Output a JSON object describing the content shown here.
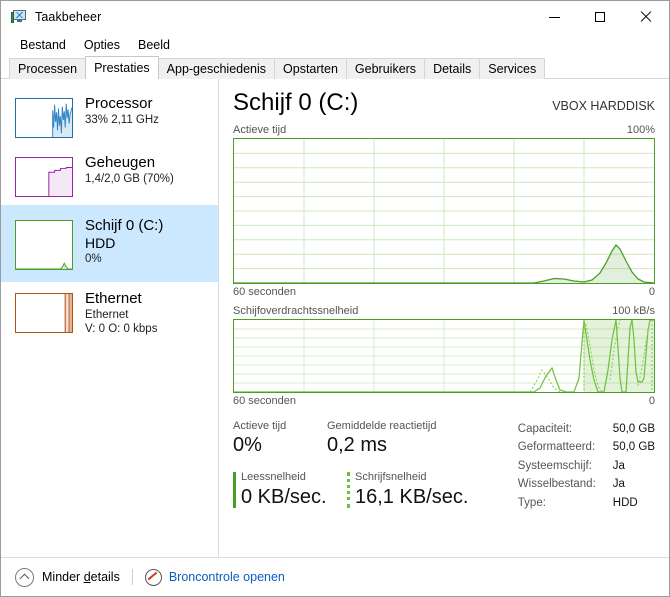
{
  "window": {
    "title": "Taakbeheer",
    "icon": "task-manager-icon",
    "controls": {
      "minimize": "—",
      "maximize": "□",
      "close": "✕"
    }
  },
  "menu": {
    "items": [
      "Bestand",
      "Opties",
      "Beeld"
    ]
  },
  "tabs": {
    "items": [
      {
        "label": "Processen",
        "active": false
      },
      {
        "label": "Prestaties",
        "active": true
      },
      {
        "label": "App-geschiedenis",
        "active": false
      },
      {
        "label": "Opstarten",
        "active": false
      },
      {
        "label": "Gebruikers",
        "active": false
      },
      {
        "label": "Details",
        "active": false
      },
      {
        "label": "Services",
        "active": false
      }
    ]
  },
  "sidebar": {
    "items": [
      {
        "title": "Processor",
        "sub": "33% 2,11 GHz",
        "sub2": "",
        "color": "#1f6fa8",
        "selected": false
      },
      {
        "title": "Geheugen",
        "sub": "1,4/2,0 GB (70%)",
        "sub2": "",
        "color": "#9b21a8",
        "selected": false
      },
      {
        "title": "Schijf 0 (C:)",
        "sub": "HDD",
        "sub2": "0%",
        "color": "#4a9e28",
        "selected": true
      },
      {
        "title": "Ethernet",
        "sub": "Ethernet",
        "sub2": "V: 0 O: 0 kbps",
        "color": "#b4501a",
        "selected": false
      }
    ]
  },
  "main": {
    "title": "Schijf 0 (C:)",
    "device": "VBOX HARDDISK",
    "graph1": {
      "caption_left": "Actieve tijd",
      "caption_right": "100%",
      "foot_left": "60 seconden",
      "foot_right": "0"
    },
    "graph2": {
      "caption_left": "Schijfoverdrachtssnelheid",
      "caption_right": "100 kB/s",
      "foot_left": "60 seconden",
      "foot_right": "0"
    },
    "stats": {
      "active_time_label": "Actieve tijd",
      "active_time_value": "0%",
      "avg_response_label": "Gemiddelde reactietijd",
      "avg_response_value": "0,2 ms",
      "read_label": "Leessnelheid",
      "read_value": "0 KB/sec.",
      "write_label": "Schrijfsnelheid",
      "write_value": "16,1 KB/sec."
    },
    "details": [
      {
        "key": "Capaciteit:",
        "value": "50,0 GB"
      },
      {
        "key": "Geformatteerd:",
        "value": "50,0 GB"
      },
      {
        "key": "Systeemschijf:",
        "value": "Ja"
      },
      {
        "key": "Wisselbestand:",
        "value": "Ja"
      },
      {
        "key": "Type:",
        "value": "HDD"
      }
    ]
  },
  "statusbar": {
    "less_details_pre": "Minder ",
    "less_details_accel": "d",
    "less_details_post": "etails",
    "resource_monitor": "Broncontrole openen"
  },
  "chart_data": [
    {
      "type": "area",
      "title": "Actieve tijd",
      "xlabel": "60 seconden",
      "ylabel": "%",
      "ylim": [
        0,
        100
      ],
      "grid": {
        "rows": 10,
        "cols": 6
      },
      "x": [
        0,
        5,
        10,
        15,
        20,
        25,
        30,
        35,
        40,
        45,
        50,
        55,
        60,
        65,
        70,
        72,
        75,
        78,
        80,
        82,
        84,
        86,
        88,
        90,
        92,
        94,
        96,
        98,
        100
      ],
      "y": [
        0,
        0,
        0,
        0,
        0,
        0,
        0,
        0,
        0,
        0,
        0,
        0,
        0,
        0,
        0,
        0,
        1,
        2,
        2,
        1,
        1,
        2,
        6,
        12,
        18,
        14,
        8,
        3,
        0
      ],
      "color": "#4a9e28",
      "fill": "#eaf6e2"
    },
    {
      "type": "area",
      "title": "Schijfoverdrachtssnelheid",
      "xlabel": "60 seconden",
      "ylabel": "kB/s",
      "ylim": [
        0,
        100
      ],
      "grid": {
        "rows": 8,
        "cols": 6
      },
      "x": [
        0,
        50,
        60,
        65,
        70,
        72,
        74,
        76,
        78,
        80,
        82,
        84,
        86,
        88,
        90,
        92,
        94,
        96,
        98,
        100
      ],
      "y": [
        0,
        0,
        0,
        2,
        30,
        8,
        2,
        40,
        95,
        60,
        20,
        5,
        55,
        95,
        40,
        10,
        60,
        95,
        50,
        40
      ],
      "color": "#6cbf3f",
      "fill": "#eaf6e2"
    }
  ]
}
